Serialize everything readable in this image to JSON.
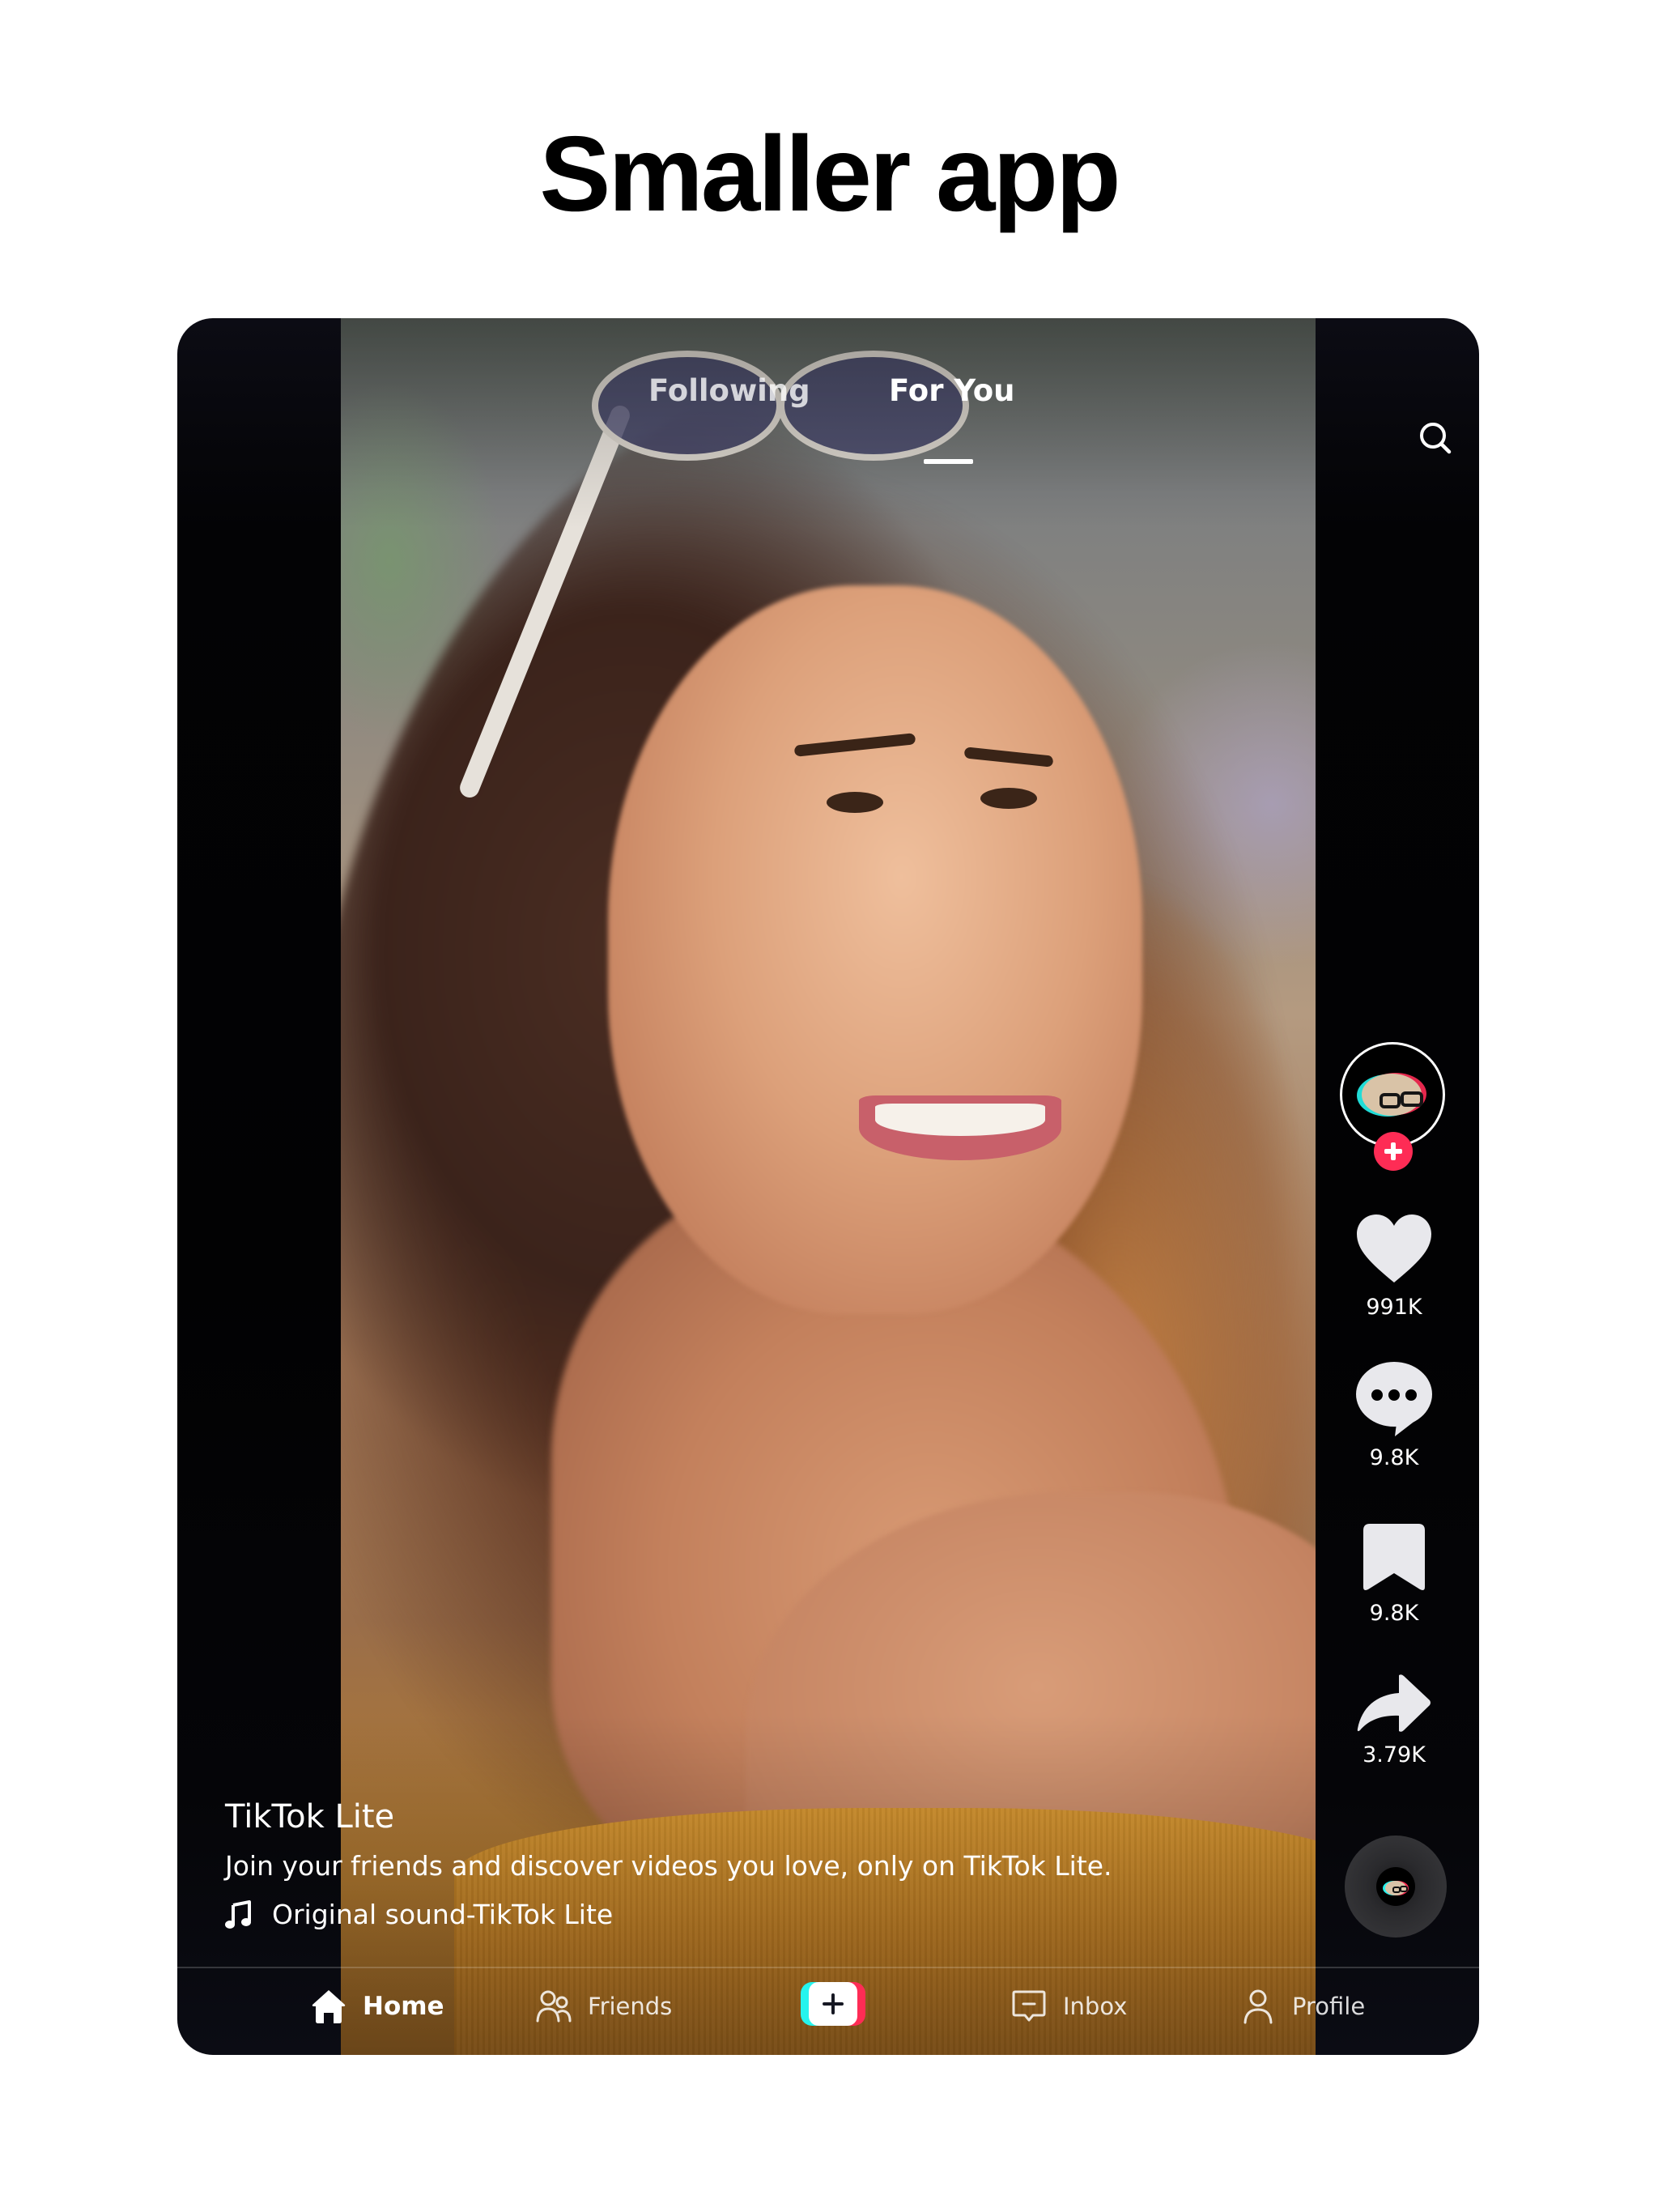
{
  "headline": "Smaller app",
  "feed": {
    "tabs": [
      {
        "label": "Following",
        "active": false
      },
      {
        "label": "For You",
        "active": true
      }
    ],
    "search_icon": "search-icon"
  },
  "actions": {
    "avatar_icon": "creator-avatar",
    "follow_icon": "plus-icon",
    "likes": "991K",
    "comments": "9.8K",
    "saves": "9.8K",
    "shares": "3.79K",
    "sound_disc_icon": "music-disc-icon"
  },
  "caption": {
    "author": "TikTok Lite",
    "description": "Join your friends and discover videos you love, only on TikTok Lite.",
    "sound": "Original sound-TikTok Lite"
  },
  "nav": {
    "items": [
      {
        "label": "Home",
        "icon": "home-icon",
        "active": true
      },
      {
        "label": "Friends",
        "icon": "friends-icon",
        "active": false
      },
      {
        "label": "",
        "icon": "create-plus-icon",
        "active": false
      },
      {
        "label": "Inbox",
        "icon": "inbox-icon",
        "active": false
      },
      {
        "label": "Profile",
        "icon": "profile-icon",
        "active": false
      }
    ]
  },
  "colors": {
    "accent_red": "#fe2c55",
    "accent_cyan": "#25f4ee",
    "frame_background": "#030305",
    "page_background": "#ffffff"
  }
}
